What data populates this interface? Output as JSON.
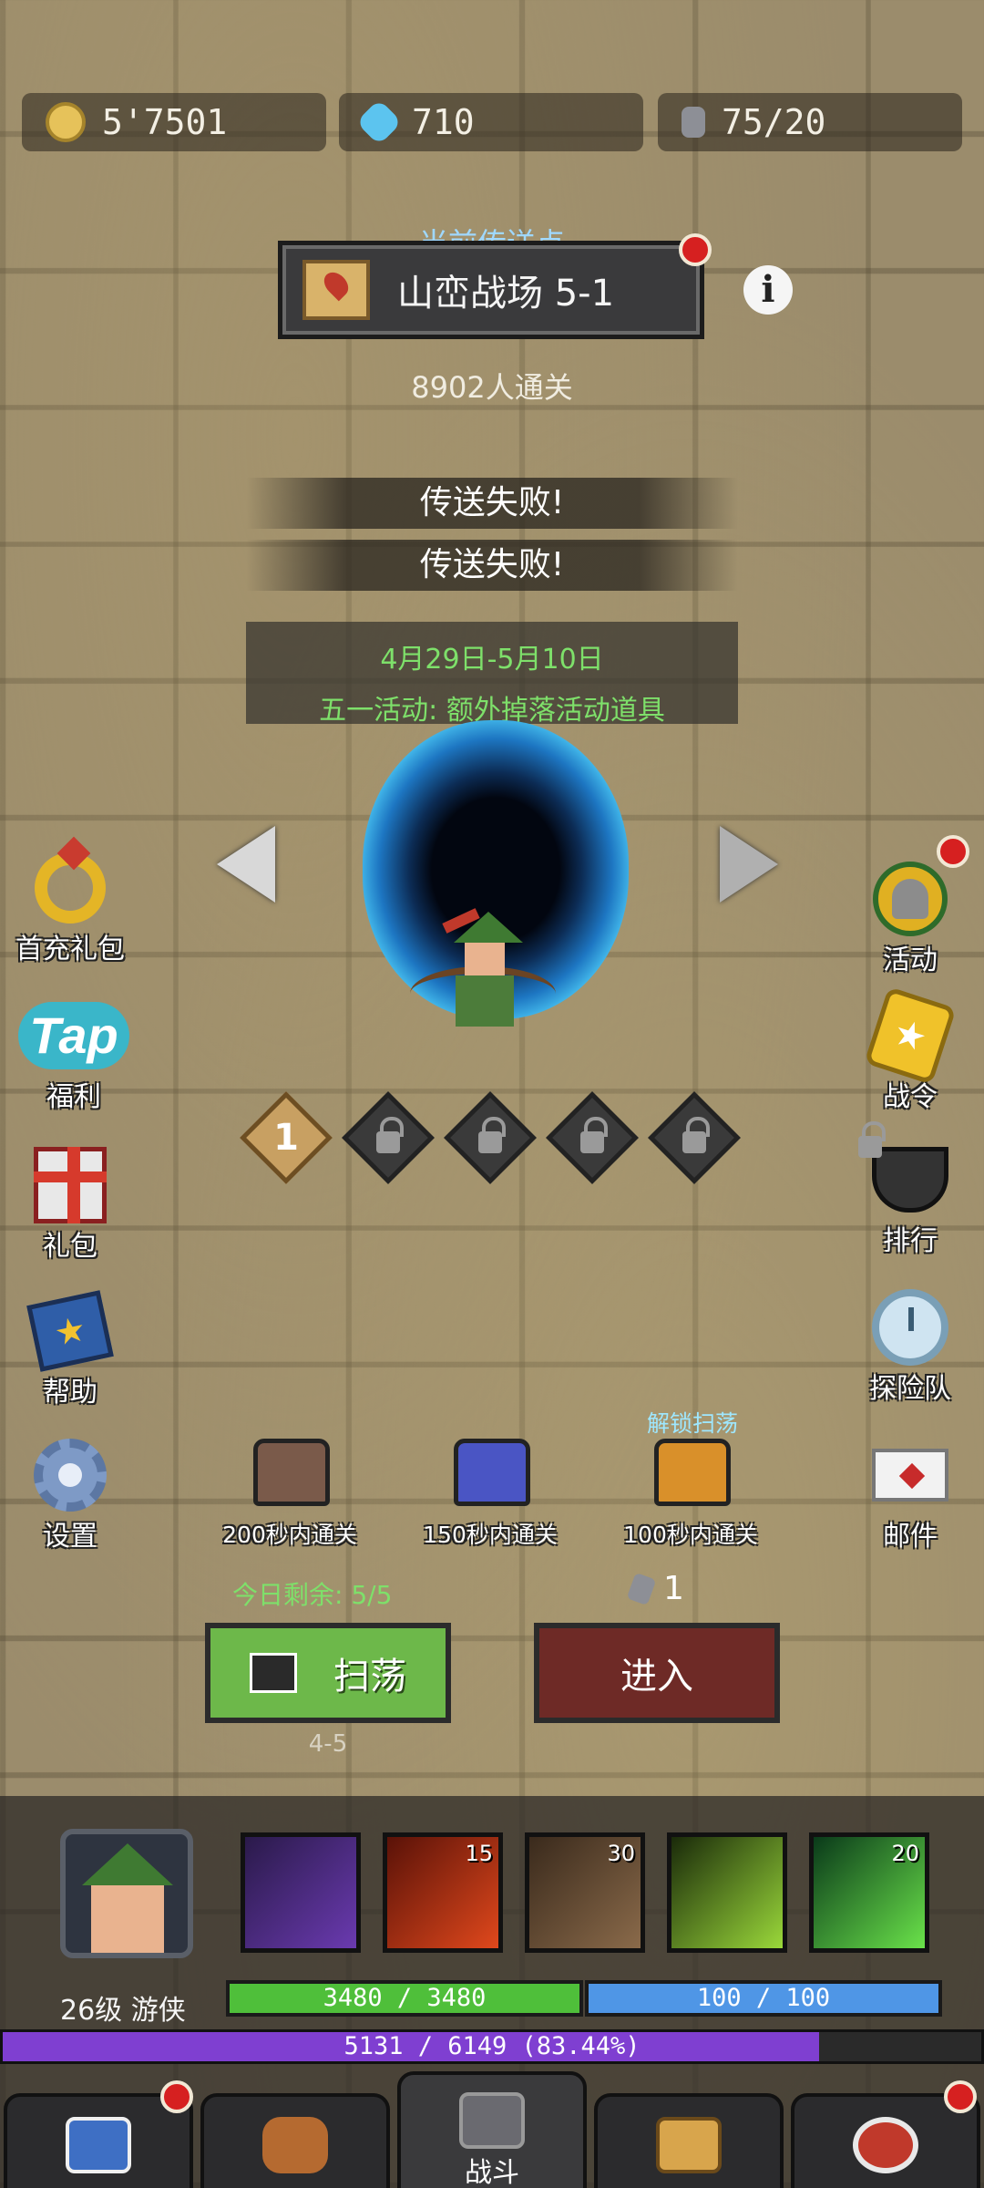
{
  "resources": {
    "gold": "5'7501",
    "diamonds": "710",
    "stamina": "75/20"
  },
  "teleport": {
    "title": "当前传送点",
    "name": "山峦战场 5-1",
    "clears": "8902人通关"
  },
  "messages": [
    "传送失败!",
    "传送失败!"
  ],
  "event": {
    "dates": "4月29日-5月10日",
    "text": "五一活动: 额外掉落活动道具"
  },
  "stages": {
    "current": "1"
  },
  "left_menu": {
    "first_recharge": "首充礼包",
    "tap_logo": "Tap",
    "welfare": "福利",
    "gift_pack": "礼包",
    "help": "帮助",
    "settings": "设置"
  },
  "right_menu": {
    "activity": "活动",
    "battle_pass": "战令",
    "ranking": "排行",
    "expedition": "探险队",
    "mail": "邮件"
  },
  "chests": [
    {
      "label": "200秒内通关",
      "color": "#7a5a4a"
    },
    {
      "label": "150秒内通关",
      "color": "#4a55c4"
    },
    {
      "label": "100秒内通关",
      "color": "#d9902a"
    }
  ],
  "unlock_sweep": "解锁扫荡",
  "today_remaining": "今日剩余: 5/5",
  "entry_cost": "1",
  "buttons": {
    "sweep": "扫荡",
    "enter": "进入",
    "sweep_range": "4-5"
  },
  "hero": {
    "level_class": "26级 游侠",
    "hp": "3480 / 3480",
    "mp": "100 / 100",
    "xp": "5131 / 6149 (83.44%)",
    "xp_fraction": 0.8344
  },
  "skills": [
    {
      "name": "dark-arrow-icon",
      "badge": ""
    },
    {
      "name": "crossbow-icon",
      "badge": "15"
    },
    {
      "name": "arrow-rain-icon",
      "badge": "30"
    },
    {
      "name": "swift-boots-icon",
      "badge": ""
    },
    {
      "name": "paw-icon",
      "badge": "20"
    }
  ],
  "nav": {
    "battle": "战斗"
  }
}
